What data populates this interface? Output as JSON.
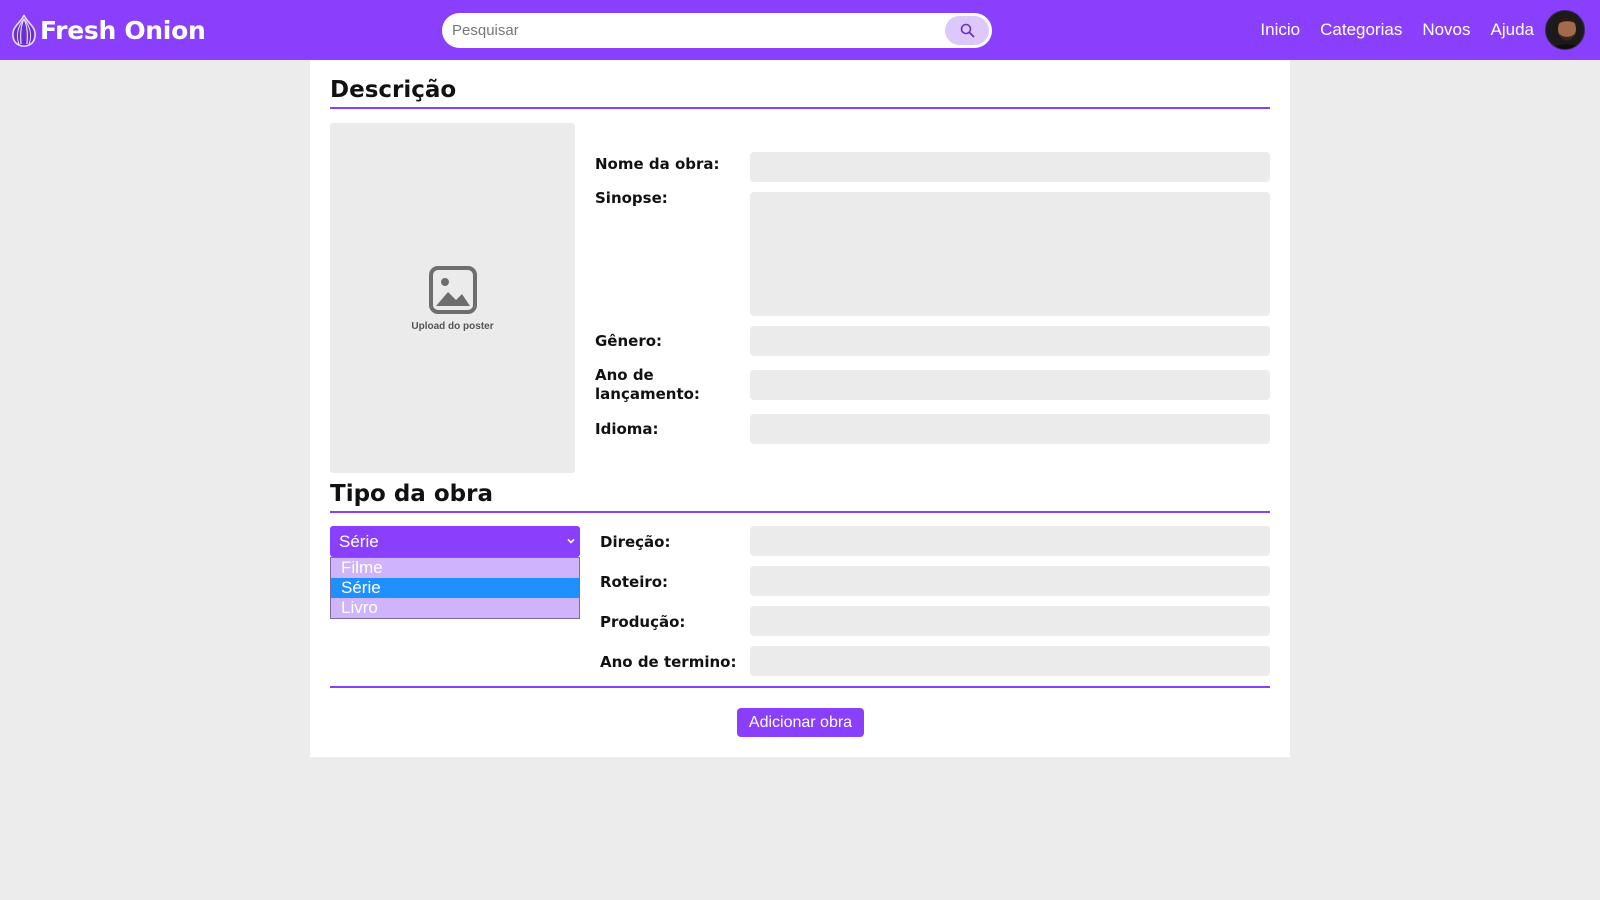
{
  "header": {
    "brand": "Fresh Onion",
    "search_placeholder": "Pesquisar",
    "nav": [
      "Inicio",
      "Categorias",
      "Novos",
      "Ajuda"
    ]
  },
  "description": {
    "title": "Descrição",
    "poster_caption": "Upload do poster",
    "fields": {
      "name": "Nome da obra:",
      "synopsis": "Sinopse:",
      "genre": "Gênero:",
      "year_line1": "Ano de",
      "year_line2": "lançamento:",
      "language": "Idioma:"
    }
  },
  "type": {
    "title": "Tipo da obra",
    "selected": "Série",
    "options": [
      "Filme",
      "Série",
      "Livro"
    ],
    "fields": {
      "direction": "Direção:",
      "script": "Roteiro:",
      "production": "Produção:",
      "end_year": "Ano de termino:"
    }
  },
  "submit_label": "Adicionar obra",
  "colors": {
    "accent": "#8a3ffc",
    "accent_light": "#cfb3fb",
    "option_highlight": "#1e90ff",
    "field_bg": "#ebebeb"
  }
}
